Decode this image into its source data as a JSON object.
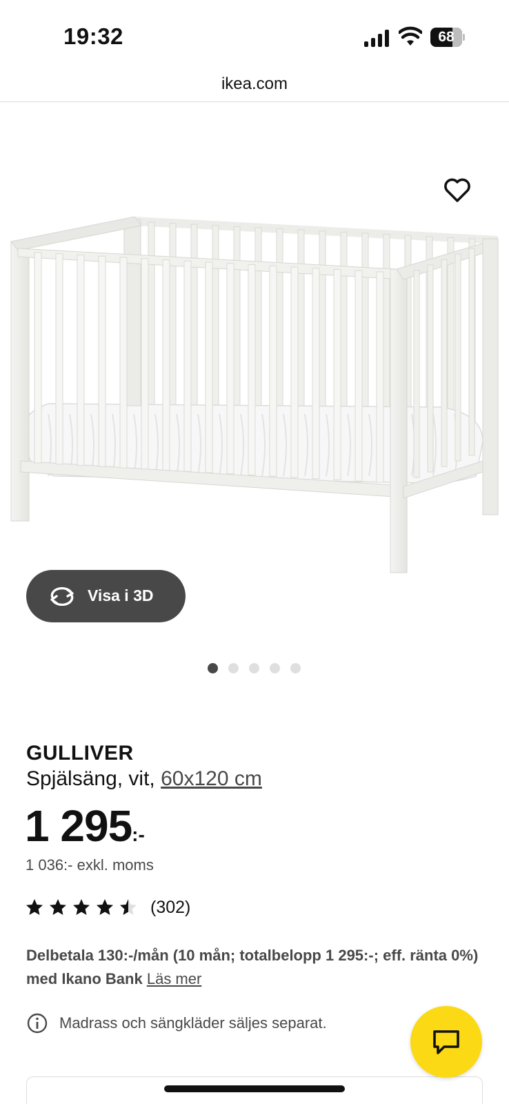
{
  "status_bar": {
    "time": "19:32",
    "battery": "68"
  },
  "browser": {
    "url": "ikea.com"
  },
  "gallery": {
    "view_3d_label": "Visa i 3D",
    "dot_count": 5,
    "active_dot": 0
  },
  "product": {
    "name": "GULLIVER",
    "description": "Spjälsäng, vit, ",
    "size": "60x120 cm",
    "price": "1 295",
    "price_suffix": ":-",
    "price_ex_vat": "1 036:- exkl. moms",
    "rating_value": 4.5,
    "rating_max": 5,
    "review_count": "(302)"
  },
  "financing": {
    "text": "Delbetala 130:-/mån (10 mån; totalbelopp 1 295:-; eff. ränta 0%) med Ikano Bank",
    "link_label": "Läs mer"
  },
  "info": {
    "text": "Madrass och sängkläder säljes separat."
  },
  "colors": {
    "accent_yellow": "#FBD914",
    "dark_gray": "#484848",
    "text_black": "#111111"
  },
  "icons": [
    "signal-icon",
    "wifi-icon",
    "battery-icon",
    "heart-icon",
    "rotate-3d-icon",
    "star-icon",
    "half-star-icon",
    "info-icon",
    "chat-icon"
  ]
}
